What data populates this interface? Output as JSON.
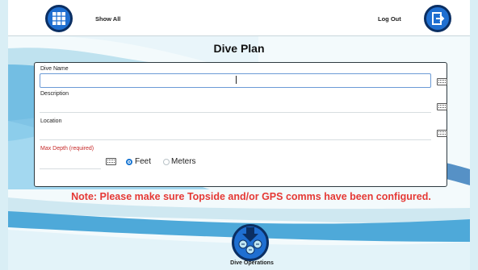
{
  "header": {
    "show_all_label": "Show All",
    "log_out_label": "Log Out"
  },
  "page": {
    "title": "Dive Plan"
  },
  "form": {
    "dive_name_label": "Dive Name",
    "dive_name_value": "",
    "description_label": "Description",
    "description_value": "",
    "location_label": "Location",
    "location_value": "",
    "max_depth_label": "Max Depth (required)",
    "max_depth_value": "",
    "unit_options": [
      "Feet",
      "Meters"
    ],
    "selected_unit": "Feet"
  },
  "note": {
    "text": "Note:  Please make sure Topside and/or GPS comms have been configured."
  },
  "footer": {
    "dive_operations_label": "Dive Operations"
  },
  "colors": {
    "accent_blue": "#1f6fd1",
    "button_border": "#0b2f63",
    "warning_red": "#e53935",
    "required_red": "#c62828",
    "radio_blue": "#1976d2"
  },
  "icons": {
    "show_all": "grid-icon",
    "log_out": "exit-door-icon",
    "keyboard": "keyboard-icon",
    "dive_operations": "diver-arrow-icon"
  }
}
